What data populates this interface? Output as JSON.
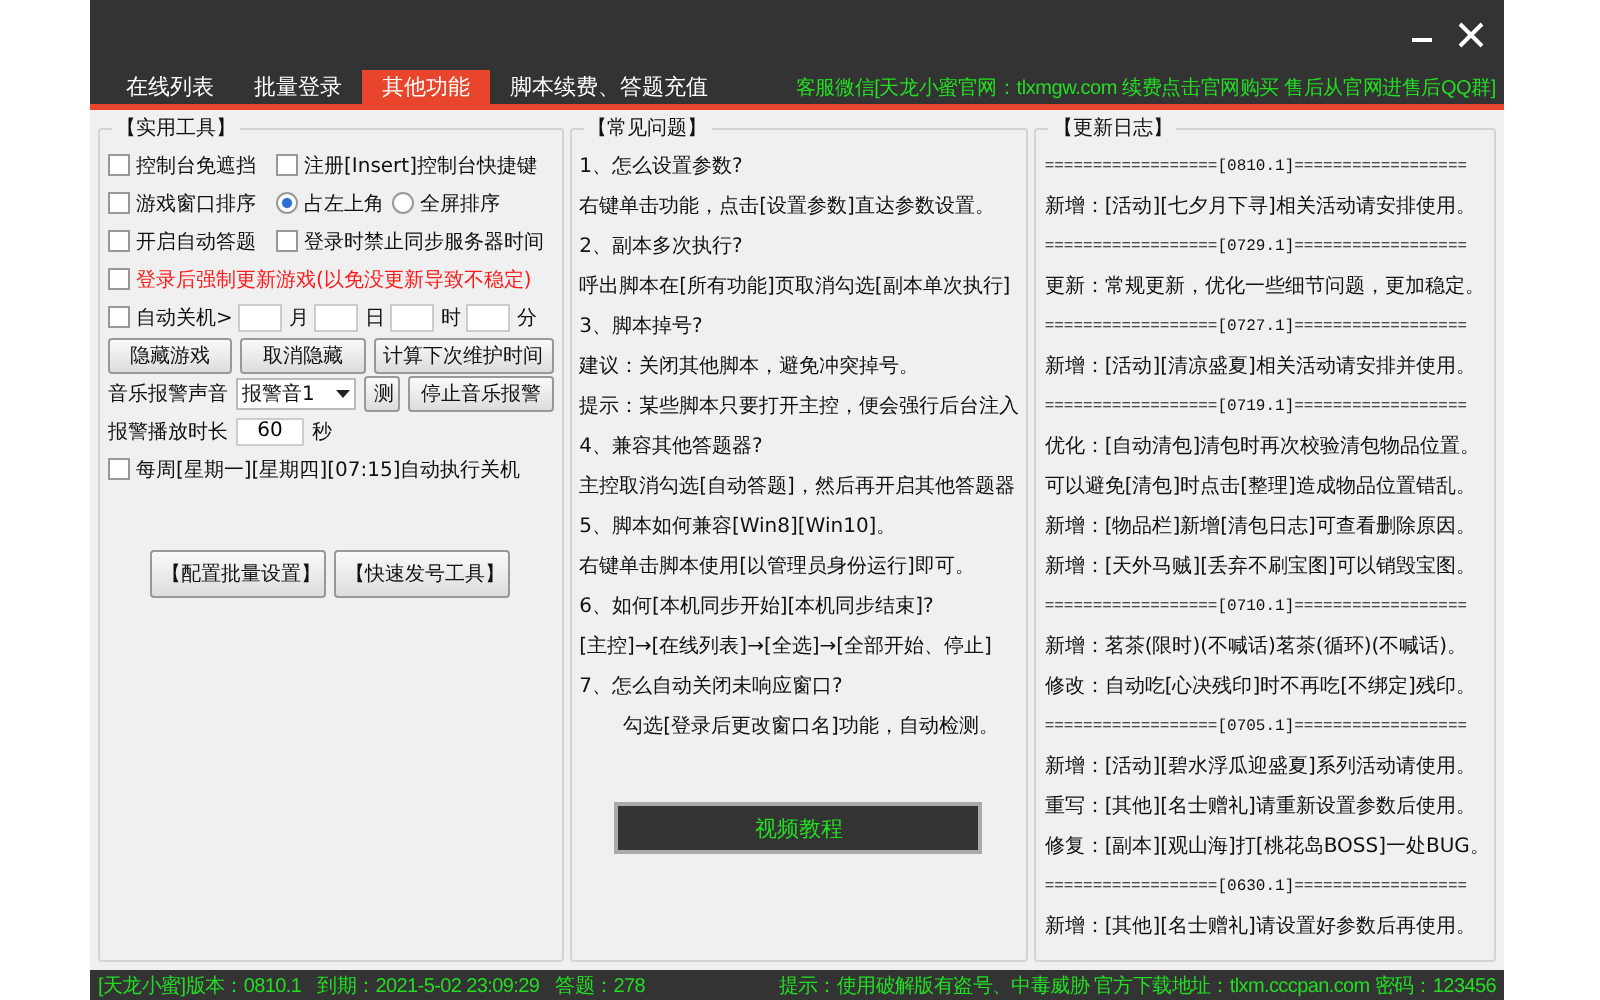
{
  "tabs": [
    {
      "label": "在线列表",
      "selected": false
    },
    {
      "label": "批量登录",
      "selected": false
    },
    {
      "label": "其他功能",
      "selected": true
    },
    {
      "label": "脚本续费、答题充值",
      "selected": false
    }
  ],
  "notice": "客服微信[天龙小蜜官网：tlxmgw.com 续费点击官网购买 售后从官网进售后QQ群]",
  "tools": {
    "title": "【实用工具】",
    "option_rows": [
      [
        {
          "kind": "checkbox",
          "label": "控制台免遮挡",
          "checked": false,
          "alert": false
        },
        {
          "kind": "checkbox",
          "label": "注册[Insert]控制台快捷键",
          "checked": false,
          "alert": false
        }
      ],
      [
        {
          "kind": "checkbox",
          "label": "游戏窗口排序",
          "checked": false,
          "alert": false
        },
        {
          "kind": "radio",
          "label": "占左上角",
          "selected": true,
          "alert": false
        },
        {
          "kind": "radio",
          "label": "全屏排序",
          "selected": false,
          "alert": false
        }
      ],
      [
        {
          "kind": "checkbox",
          "label": "开启自动答题",
          "checked": false,
          "alert": false
        },
        {
          "kind": "checkbox",
          "label": "登录时禁止同步服务器时间",
          "checked": false,
          "alert": false
        }
      ],
      [
        {
          "kind": "checkbox",
          "label": "登录后强制更新游戏(以免没更新导致不稳定)",
          "checked": false,
          "alert": true
        }
      ]
    ],
    "auto_shutdown": {
      "label": "自动关机>",
      "checked": false,
      "units": [
        "月",
        "日",
        "时",
        "分"
      ]
    },
    "buttons": [
      "隐藏游戏",
      "取消隐藏",
      "计算下次维护时间"
    ],
    "alarm": {
      "label": "音乐报警声音",
      "value": "报警音1",
      "test": "测",
      "stop": "停止音乐报警"
    },
    "duration": {
      "label": "报警播放时长",
      "value": "60",
      "unit": "秒"
    },
    "weekly": {
      "label": "每周[星期一][星期四][07:15]自动执行关机",
      "checked": false
    },
    "bottom_buttons": [
      "【配置批量设置】",
      "【快速发号工具】"
    ]
  },
  "faq": {
    "title": "【常见问题】",
    "lines": [
      {
        "kind": "question",
        "text": "1、怎么设置参数?"
      },
      {
        "kind": "answer",
        "text": "右键单击功能，点击[设置参数]直达参数设置。"
      },
      {
        "kind": "question",
        "text": "2、副本多次执行?"
      },
      {
        "kind": "answer",
        "text": "呼出脚本在[所有功能]页取消勾选[副本单次执行]"
      },
      {
        "kind": "question",
        "text": "3、脚本掉号?"
      },
      {
        "kind": "answer",
        "text": "建议：关闭其他脚本，避免冲突掉号。"
      },
      {
        "kind": "answer",
        "text": "提示：某些脚本只要打开主控，便会强行后台注入"
      },
      {
        "kind": "question",
        "text": "4、兼容其他答题器?"
      },
      {
        "kind": "answer",
        "text": "主控取消勾选[自动答题]，然后再开启其他答题器"
      },
      {
        "kind": "question",
        "text": "5、脚本如何兼容[Win8][Win10]。"
      },
      {
        "kind": "answer",
        "text": "右键单击脚本使用[以管理员身份运行]即可。"
      },
      {
        "kind": "question",
        "text": "6、如何[本机同步开始][本机同步结束]?"
      },
      {
        "kind": "answer",
        "text": "[主控]→[在线列表]→[全选]→[全部开始、停止]"
      },
      {
        "kind": "question",
        "text": "7、怎么自动关闭未响应窗口?"
      },
      {
        "kind": "indented",
        "text": "勾选[登录后更改窗口名]功能，自动检测。"
      }
    ],
    "video_button": "视频教程"
  },
  "changelog": {
    "title": "【更新日志】",
    "lines": [
      {
        "kind": "separator",
        "text": "==================[0810.1]=================="
      },
      {
        "kind": "entry",
        "text": "新增：[活动][七夕月下寻]相关活动请安排使用。"
      },
      {
        "kind": "separator",
        "text": "==================[0729.1]=================="
      },
      {
        "kind": "entry",
        "text": "更新：常规更新，优化一些细节问题，更加稳定。"
      },
      {
        "kind": "separator",
        "text": "==================[0727.1]=================="
      },
      {
        "kind": "entry",
        "text": "新增：[活动][清凉盛夏]相关活动请安排并使用。"
      },
      {
        "kind": "separator",
        "text": "==================[0719.1]=================="
      },
      {
        "kind": "entry",
        "text": "优化：[自动清包]清包时再次校验清包物品位置。"
      },
      {
        "kind": "entry",
        "text": "可以避免[清包]时点击[整理]造成物品位置错乱。"
      },
      {
        "kind": "entry",
        "text": "新增：[物品栏]新增[清包日志]可查看删除原因。"
      },
      {
        "kind": "entry",
        "text": "新增：[天外马贼][丢弃不刷宝图]可以销毁宝图。"
      },
      {
        "kind": "separator",
        "text": "==================[0710.1]=================="
      },
      {
        "kind": "entry",
        "text": "新增：茗茶(限时)(不喊话)茗茶(循环)(不喊话)。"
      },
      {
        "kind": "entry",
        "text": "修改：自动吃[心决残印]时不再吃[不绑定]残印。"
      },
      {
        "kind": "separator",
        "text": "==================[0705.1]=================="
      },
      {
        "kind": "entry",
        "text": "新增：[活动][碧水浮瓜迎盛夏]系列活动请使用。"
      },
      {
        "kind": "entry",
        "text": "重写：[其他][名士赠礼]请重新设置参数后使用。"
      },
      {
        "kind": "entry",
        "text": "修复：[副本][观山海]打[桃花岛BOSS]一处BUG。"
      },
      {
        "kind": "separator",
        "text": "==================[0630.1]=================="
      },
      {
        "kind": "entry",
        "text": "新增：[其他][名士赠礼]请设置好参数后再使用。"
      }
    ]
  },
  "status_bar": {
    "left": [
      "[天龙小蜜]版本：0810.1",
      "到期：2021-5-02 23:09:29",
      "答题：278"
    ],
    "tip": "提示：使用破解版有盗号、中毒威胁 官方下载地址：tlxm.cccpan.com 密码：123456"
  }
}
